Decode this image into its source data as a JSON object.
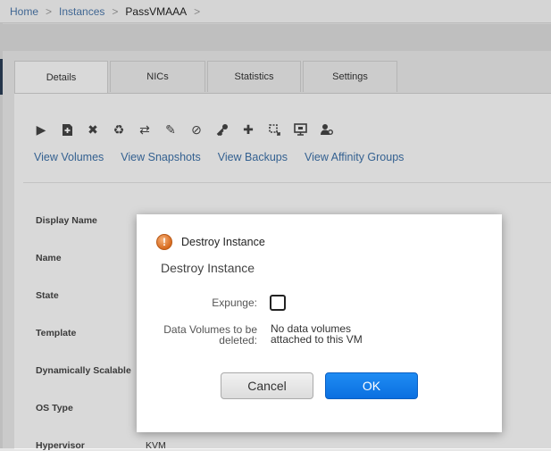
{
  "breadcrumb": {
    "home": "Home",
    "instances": "Instances",
    "current": "PassVMAAA",
    "sep": ">"
  },
  "tabs": [
    "Details",
    "NICs",
    "Statistics",
    "Settings"
  ],
  "action_icons": [
    "start-icon",
    "snapshot-icon",
    "destroy-icon",
    "reinstall-icon",
    "migrate-icon",
    "edit-icon",
    "attach-iso-icon",
    "reset-key-icon",
    "scale-icon",
    "resize-icon",
    "console-icon",
    "assign-icon"
  ],
  "links": [
    "View Volumes",
    "View Snapshots",
    "View Backups",
    "View Affinity Groups"
  ],
  "details": [
    {
      "label": "Display Name",
      "value": ""
    },
    {
      "label": "Name",
      "value": ""
    },
    {
      "label": "State",
      "value": ""
    },
    {
      "label": "Template",
      "value": ""
    },
    {
      "label": "Dynamically Scalable",
      "value": ""
    },
    {
      "label": "OS Type",
      "value": ""
    },
    {
      "label": "Hypervisor",
      "value": "KVM"
    }
  ],
  "dialog": {
    "title": "Destroy Instance",
    "subtitle": "Destroy Instance",
    "expunge_label": "Expunge:",
    "volumes_label_line1": "Data Volumes to be",
    "volumes_label_line2": "deleted:",
    "volumes_value_line1": "No data volumes",
    "volumes_value_line2": "attached to this VM",
    "cancel": "Cancel",
    "ok": "OK"
  },
  "colors": {
    "link": "#3c6fa5",
    "ok_button": "#1a82ee",
    "warning": "#d86a1e"
  }
}
